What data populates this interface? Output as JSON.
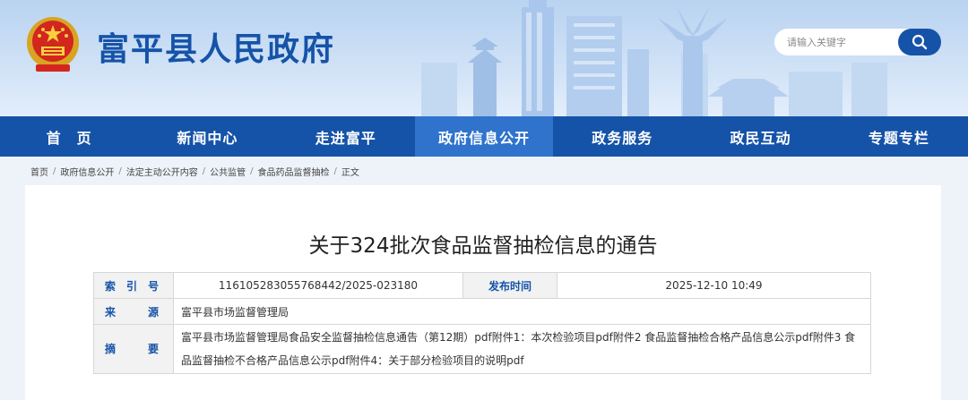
{
  "header": {
    "site_title": "富平县人民政府",
    "search_placeholder": "请输入关键字",
    "emblem_icon": "national-emblem-icon",
    "search_icon": "search-icon",
    "brand_color": "#1553a8"
  },
  "nav": {
    "items": [
      {
        "label": "首　页"
      },
      {
        "label": "新闻中心"
      },
      {
        "label": "走进富平"
      },
      {
        "label": "政府信息公开",
        "active": true
      },
      {
        "label": "政务服务"
      },
      {
        "label": "政民互动"
      },
      {
        "label": "专题专栏"
      }
    ]
  },
  "breadcrumb": [
    "首页",
    "政府信息公开",
    "法定主动公开内容",
    "公共监管",
    "食品药品监督抽检",
    "正文"
  ],
  "article": {
    "title": "关于324批次食品监督抽检信息的通告",
    "info": {
      "index_label": "索 引 号",
      "index_value": "116105283055768442/2025-023180",
      "date_label": "发布时间",
      "date_value": "2025-12-10 10:49",
      "source_label": "来　　源",
      "source_value": "富平县市场监督管理局",
      "summary_label": "摘　　要",
      "summary_value": "富平县市场监督管理局食品安全监督抽检信息通告（第12期）pdf附件1：本次检验项目pdf附件2 食品监督抽检合格产品信息公示pdf附件3 食品监督抽检不合格产品信息公示pdf附件4：关于部分检验项目的说明pdf"
    }
  }
}
